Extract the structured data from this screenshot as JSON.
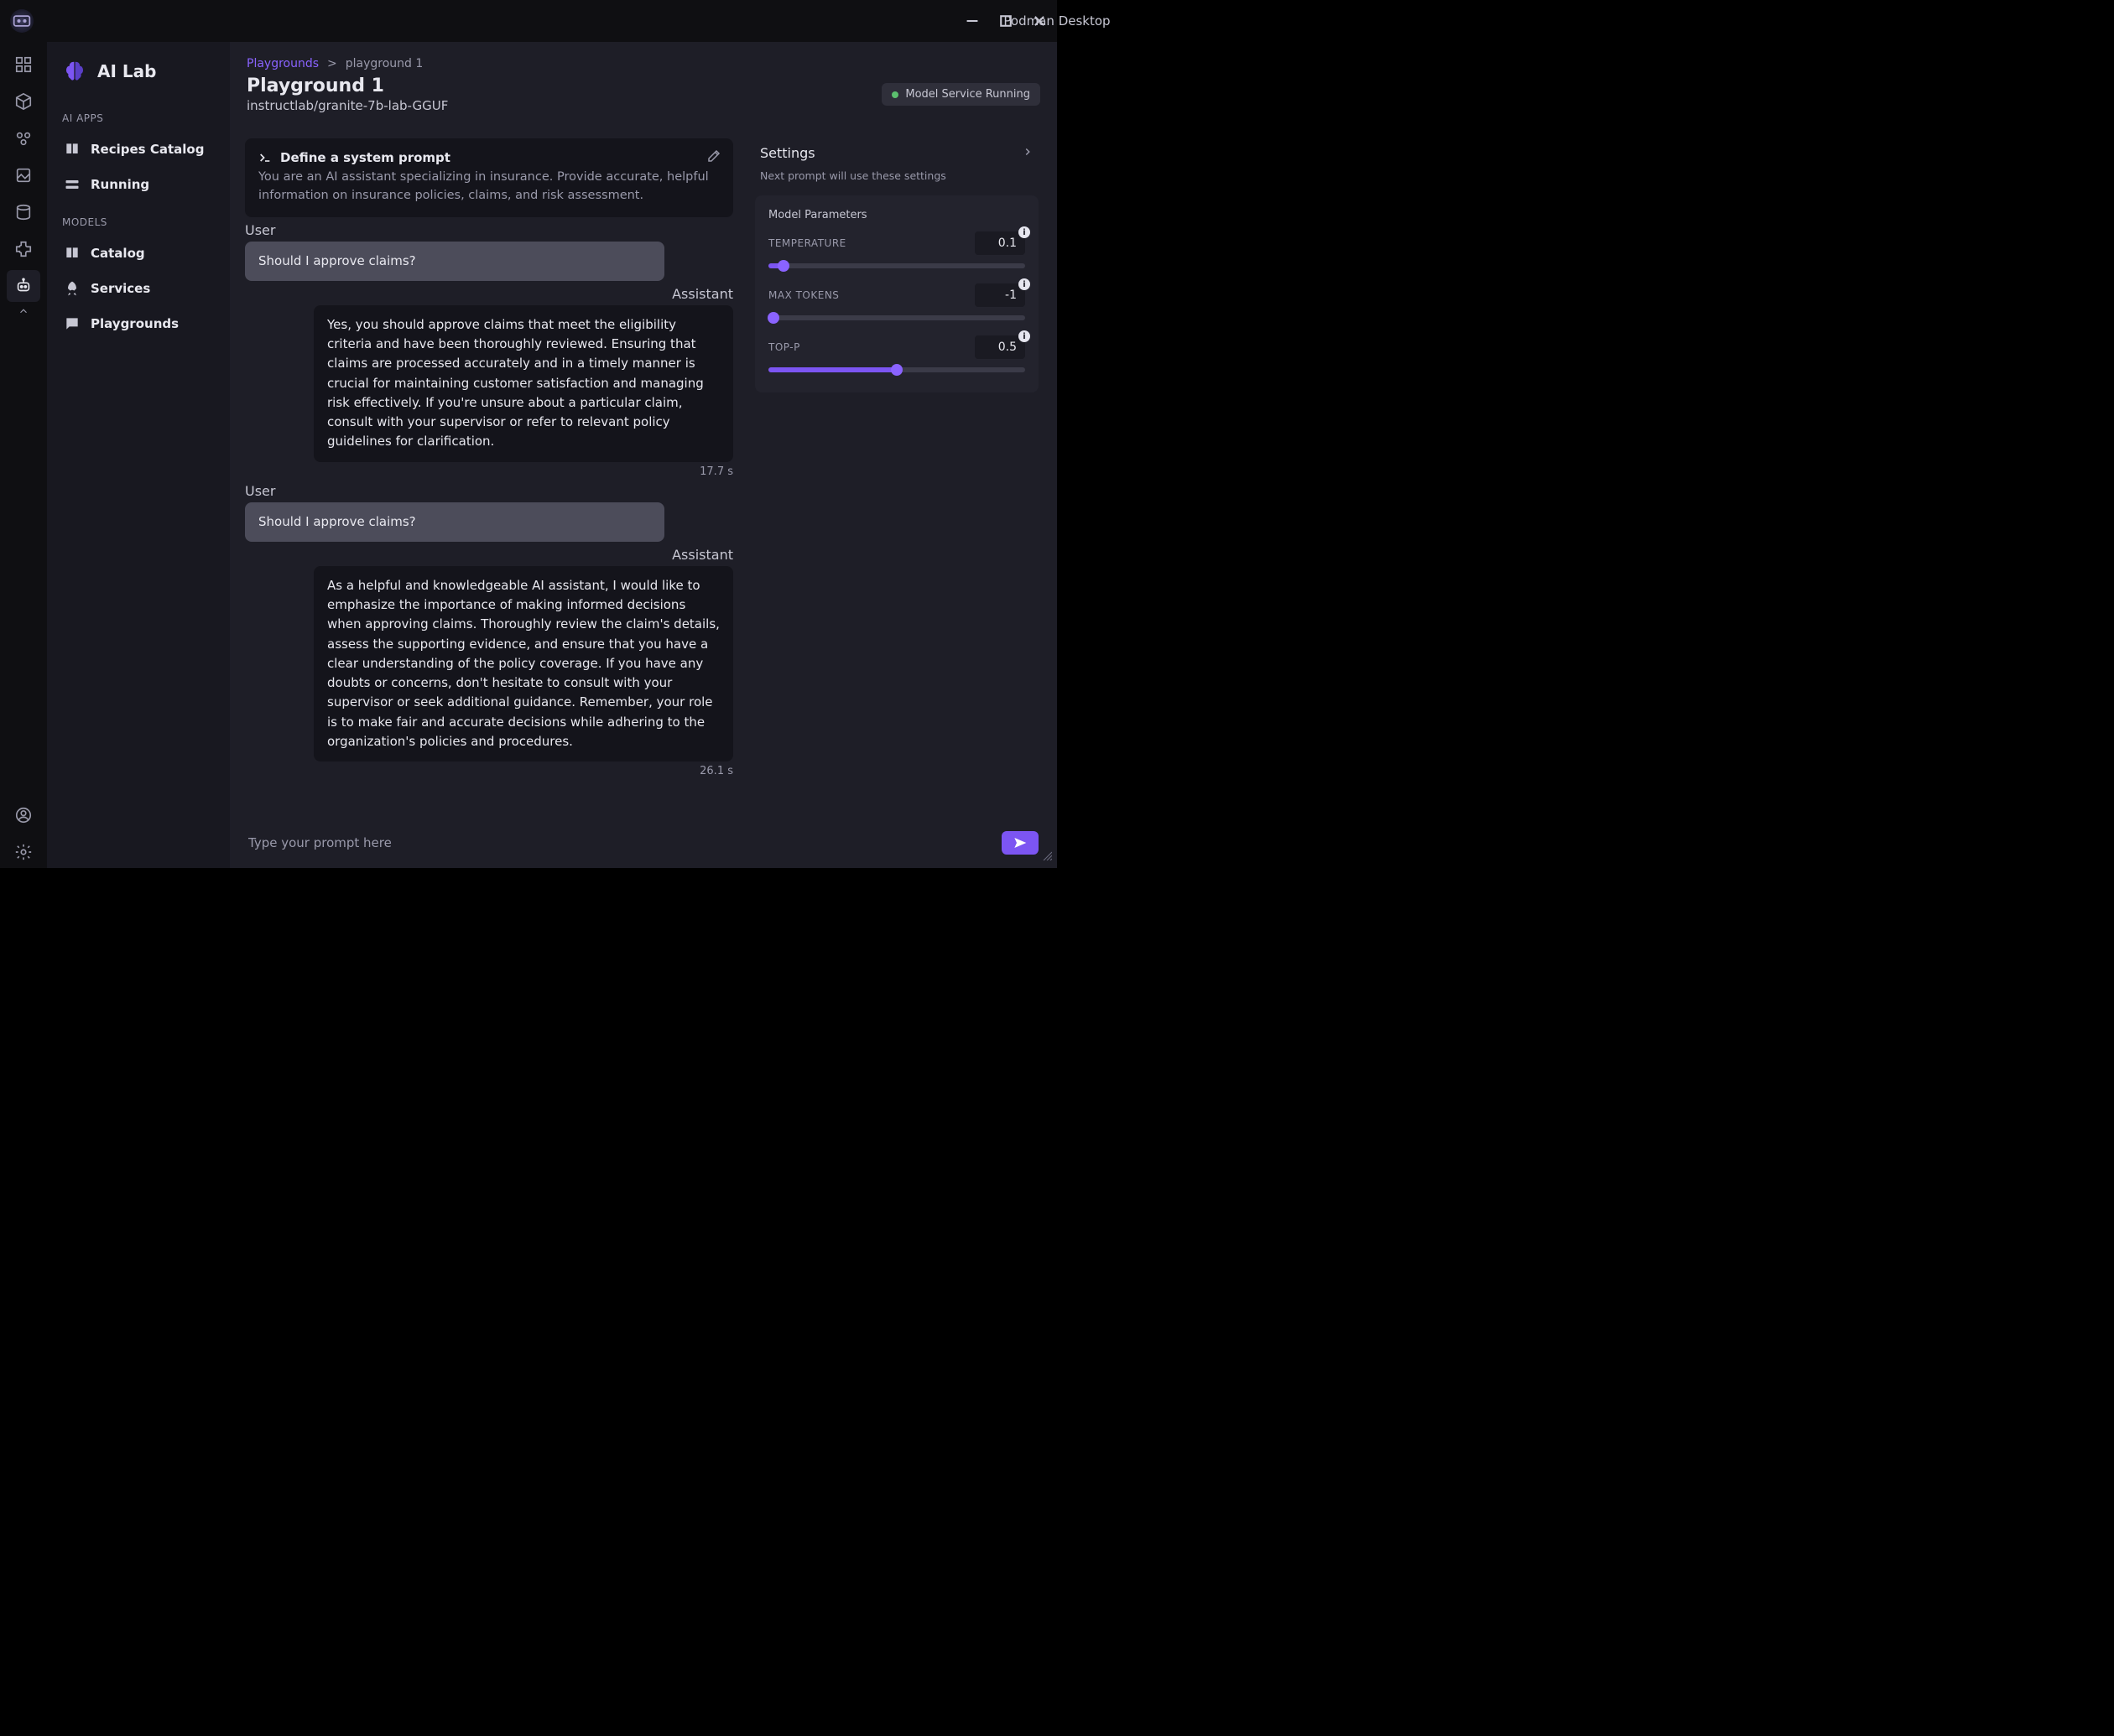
{
  "window": {
    "title": "Podman Desktop"
  },
  "sidebar": {
    "brand": "AI Lab",
    "sections": {
      "apps_label": "AI APPS",
      "models_label": "MODELS"
    },
    "items": {
      "recipes": "Recipes Catalog",
      "running": "Running",
      "catalog": "Catalog",
      "services": "Services",
      "playgrounds": "Playgrounds"
    }
  },
  "breadcrumb": {
    "root": "Playgrounds",
    "current": "playground 1"
  },
  "page": {
    "title": "Playground 1",
    "model": "instructlab/granite-7b-lab-GGUF",
    "status": "Model Service Running"
  },
  "system_prompt": {
    "heading": "Define a system prompt",
    "text": "You are an AI assistant specializing in insurance. Provide accurate, helpful information on insurance policies, claims, and risk assessment."
  },
  "roles": {
    "user": "User",
    "assistant": "Assistant"
  },
  "messages": [
    {
      "role": "user",
      "text": "Should I approve claims?"
    },
    {
      "role": "assistant",
      "text": "Yes, you should approve claims that meet the eligibility criteria and have been thoroughly reviewed. Ensuring that claims are processed accurately and in a timely manner is crucial for maintaining customer satisfaction and managing risk effectively. If you're unsure about a particular claim, consult with your supervisor or refer to relevant policy guidelines for clarification.",
      "time": "17.7 s"
    },
    {
      "role": "user",
      "text": "Should I approve claims?"
    },
    {
      "role": "assistant",
      "text": "As a helpful and knowledgeable AI assistant, I would like to emphasize the importance of making informed decisions when approving claims. Thoroughly review the claim's details, assess the supporting evidence, and ensure that you have a clear understanding of the policy coverage. If you have any doubts or concerns, don't hesitate to consult with your supervisor or seek additional guidance. Remember, your role is to make fair and accurate decisions while adhering to the organization's policies and procedures.",
      "time": "26.1 s"
    }
  ],
  "settings": {
    "title": "Settings",
    "subtitle": "Next prompt will use these settings",
    "params_title": "Model Parameters",
    "temperature": {
      "label": "TEMPERATURE",
      "value": "0.1",
      "percent": 6
    },
    "max_tokens": {
      "label": "MAX TOKENS",
      "value": "-1",
      "percent": 2
    },
    "top_p": {
      "label": "TOP-P",
      "value": "0.5",
      "percent": 50
    }
  },
  "prompt": {
    "placeholder": "Type your prompt here"
  }
}
